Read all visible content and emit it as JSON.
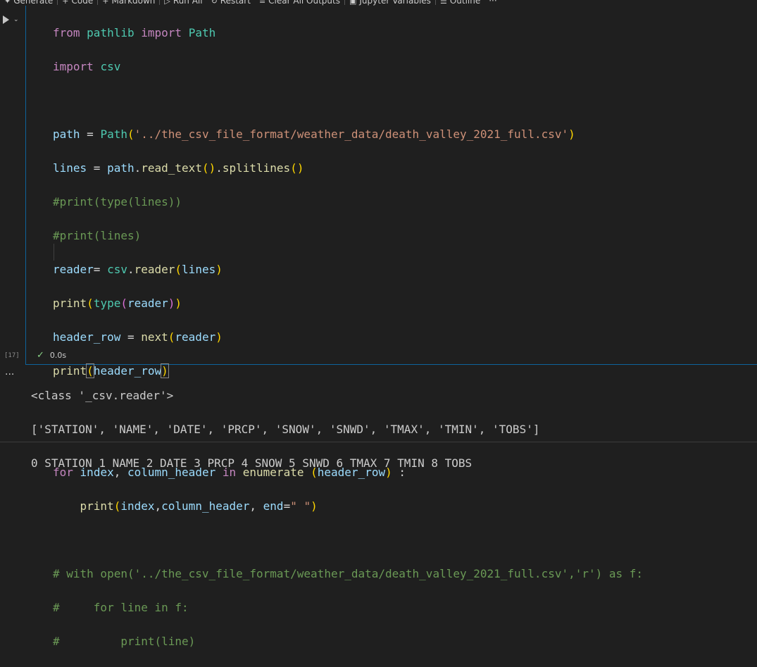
{
  "toolbar": {
    "items": [
      "Generate",
      "Code",
      "Markdown",
      "Run All",
      "Restart",
      "Clear All Outputs",
      "Jupyter Variables",
      "Outline"
    ],
    "more": "···"
  },
  "cell": {
    "execution_count": "[17]",
    "status_time": "0.0s",
    "code_lines": [
      "from pathlib import Path",
      "import csv",
      "",
      "path = Path('../the_csv_file_format/weather_data/death_valley_2021_full.csv')",
      "lines = path.read_text().splitlines()",
      "#print(type(lines))",
      "#print(lines)",
      "reader= csv.reader(lines)",
      "print(type(reader))",
      "header_row = next(reader)",
      "print(header_row)",
      "",
      "",
      "for index, column_header in enumerate (header_row) :",
      "    print(index,column_header, end=\" \")",
      "",
      "# with open('../the_csv_file_format/weather_data/death_valley_2021_full.csv','r') as f:",
      "#     for line in f:",
      "#         print(line)"
    ]
  },
  "output": {
    "dots": "···",
    "lines": [
      "<class '_csv.reader'>",
      "['STATION', 'NAME', 'DATE', 'PRCP', 'SNOW', 'SNWD', 'TMAX', 'TMIN', 'TOBS']",
      "0 STATION 1 NAME 2 DATE 3 PRCP 4 SNOW 5 SNWD 6 TMAX 7 TMIN 8 TOBS"
    ]
  }
}
